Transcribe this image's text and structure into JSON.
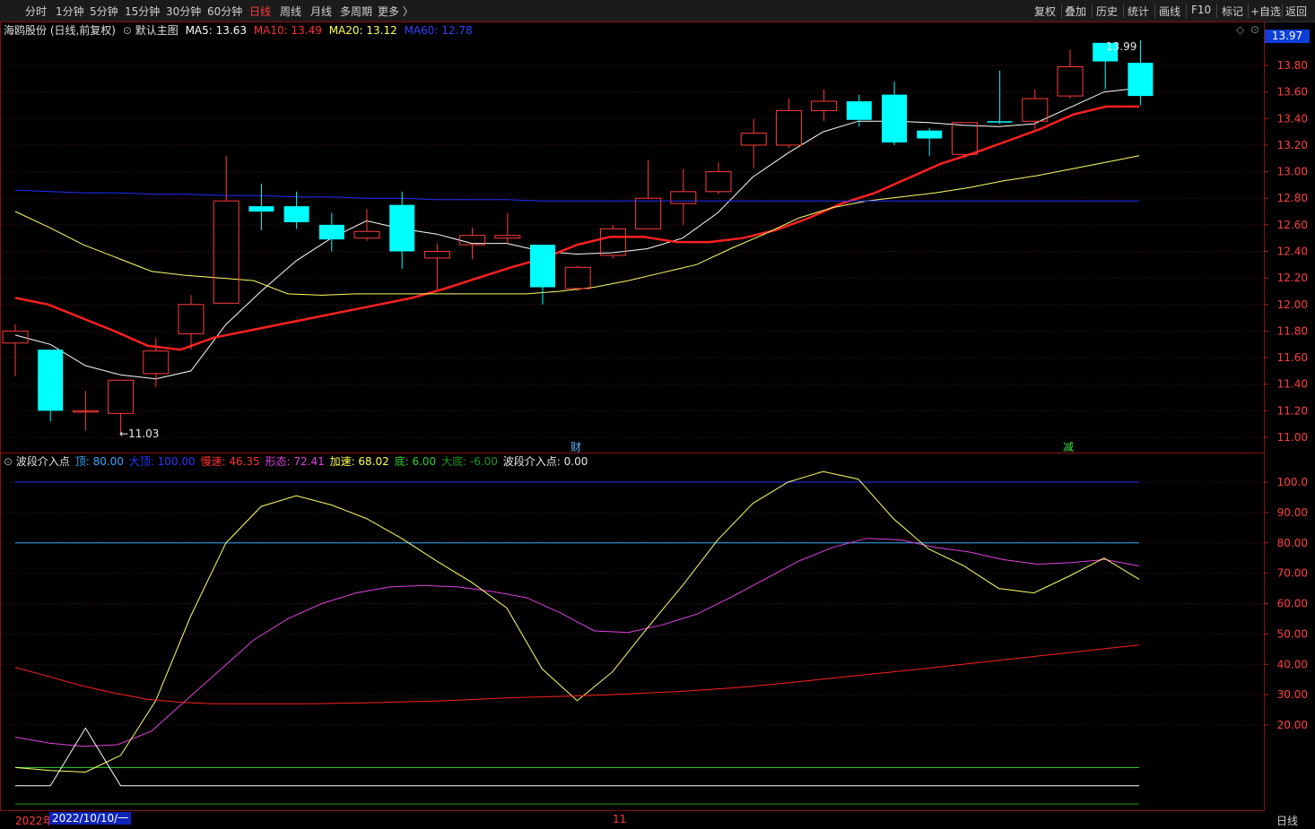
{
  "toolbar": {
    "periods": [
      "分时",
      "1分钟",
      "5分钟",
      "15分钟",
      "30分钟",
      "60分钟",
      "日线",
      "周线",
      "月线",
      "多周期",
      "更多 〉"
    ],
    "active_period": "日线",
    "right": [
      "复权",
      "叠加",
      "历史",
      "统计",
      "画线",
      "F10",
      "标记",
      "+自选",
      "返回"
    ]
  },
  "main_info": {
    "stock": "海鸥股份 (日线,前复权)",
    "template": "默认主图",
    "ma5": "MA5: 13.63",
    "ma10": "MA10: 13.49",
    "ma20": "MA20: 13.12",
    "ma60": "MA60: 12.78"
  },
  "current_price": "13.97",
  "price_axis": [
    "13.80",
    "13.60",
    "13.40",
    "13.20",
    "13.00",
    "12.80",
    "12.60",
    "12.40",
    "12.20",
    "12.00",
    "11.80",
    "11.60",
    "11.40",
    "11.20",
    "11.00"
  ],
  "annotations": {
    "high": "13.99",
    "low": "←11.03",
    "marker_cai": "财",
    "marker_jian": "减"
  },
  "indicator_info": {
    "name": "波段介入点",
    "top": "顶: 80.00",
    "big_top": "大顶: 100.00",
    "slow": "慢速: 46.35",
    "shape": "形态: 72.41",
    "fast": "加速: 68.02",
    "bottom": "底: 6.00",
    "big_bottom": "大底: -6.00",
    "entry": "波段介入点: 0.00"
  },
  "indicator_axis": [
    "100.0",
    "90.00",
    "80.00",
    "70.00",
    "60.00",
    "50.00",
    "40.00",
    "30.00",
    "20.00"
  ],
  "bottom_bar": {
    "year": "2022年",
    "date": "2022/10/10/一",
    "month": "11",
    "period": "日线"
  },
  "colors": {
    "up": "#ff3b3b",
    "down": "#00ffff",
    "ma5": "#ffffff",
    "ma10": "#ff2020",
    "ma20": "#ffff66",
    "ma60": "#2030ff"
  },
  "chart_data": {
    "type": "candlestick",
    "candles": [
      {
        "o": 11.71,
        "c": 11.8,
        "h": 11.85,
        "l": 11.46
      },
      {
        "o": 11.66,
        "c": 11.2,
        "h": 11.66,
        "l": 11.12
      },
      {
        "o": 11.2,
        "c": 11.2,
        "h": 11.35,
        "l": 11.05
      },
      {
        "o": 11.18,
        "c": 11.43,
        "h": 11.43,
        "l": 11.03
      },
      {
        "o": 11.48,
        "c": 11.65,
        "h": 11.75,
        "l": 11.38
      },
      {
        "o": 11.78,
        "c": 12.0,
        "h": 12.07,
        "l": 11.66
      },
      {
        "o": 12.01,
        "c": 12.78,
        "h": 13.12,
        "l": 12.01
      },
      {
        "o": 12.74,
        "c": 12.7,
        "h": 12.91,
        "l": 12.56
      },
      {
        "o": 12.74,
        "c": 12.62,
        "h": 12.85,
        "l": 12.57
      },
      {
        "o": 12.6,
        "c": 12.49,
        "h": 12.69,
        "l": 12.4
      },
      {
        "o": 12.5,
        "c": 12.55,
        "h": 12.72,
        "l": 12.48
      },
      {
        "o": 12.75,
        "c": 12.4,
        "h": 12.85,
        "l": 12.27
      },
      {
        "o": 12.35,
        "c": 12.4,
        "h": 12.46,
        "l": 12.11
      },
      {
        "o": 12.45,
        "c": 12.52,
        "h": 12.58,
        "l": 12.34
      },
      {
        "o": 12.5,
        "c": 12.52,
        "h": 12.69,
        "l": 12.46
      },
      {
        "o": 12.45,
        "c": 12.13,
        "h": 12.45,
        "l": 12.0
      },
      {
        "o": 12.12,
        "c": 12.28,
        "h": 12.29,
        "l": 12.1
      },
      {
        "o": 12.37,
        "c": 12.57,
        "h": 12.6,
        "l": 12.35
      },
      {
        "o": 12.57,
        "c": 12.8,
        "h": 13.09,
        "l": 12.57
      },
      {
        "o": 12.76,
        "c": 12.85,
        "h": 13.02,
        "l": 12.6
      },
      {
        "o": 12.85,
        "c": 13.0,
        "h": 13.07,
        "l": 12.83
      },
      {
        "o": 13.2,
        "c": 13.29,
        "h": 13.4,
        "l": 13.03
      },
      {
        "o": 13.2,
        "c": 13.46,
        "h": 13.55,
        "l": 13.18
      },
      {
        "o": 13.46,
        "c": 13.53,
        "h": 13.62,
        "l": 13.38
      },
      {
        "o": 13.53,
        "c": 13.39,
        "h": 13.58,
        "l": 13.34
      },
      {
        "o": 13.58,
        "c": 13.22,
        "h": 13.68,
        "l": 13.2
      },
      {
        "o": 13.31,
        "c": 13.25,
        "h": 13.33,
        "l": 13.12
      },
      {
        "o": 13.13,
        "c": 13.37,
        "h": 13.37,
        "l": 13.1
      },
      {
        "o": 13.38,
        "c": 13.37,
        "h": 13.76,
        "l": 13.36
      },
      {
        "o": 13.38,
        "c": 13.55,
        "h": 13.62,
        "l": 13.32
      },
      {
        "o": 13.57,
        "c": 13.79,
        "h": 13.92,
        "l": 13.55
      },
      {
        "o": 13.97,
        "c": 13.83,
        "h": 13.97,
        "l": 13.62
      },
      {
        "o": 13.82,
        "c": 13.57,
        "h": 13.99,
        "l": 13.5
      }
    ],
    "ma_series": [
      {
        "name": "MA5",
        "values": [
          11.77,
          11.7,
          11.54,
          11.47,
          11.44,
          11.5,
          11.85,
          12.1,
          12.33,
          12.5,
          12.63,
          12.57,
          12.53,
          12.46,
          12.46,
          12.4,
          12.38,
          12.39,
          12.42,
          12.5,
          12.69,
          12.96,
          13.14,
          13.3,
          13.38,
          13.38,
          13.37,
          13.35,
          13.34,
          13.36,
          13.48,
          13.6,
          13.63
        ]
      },
      {
        "name": "MA10",
        "values": [
          12.05,
          12.0,
          11.9,
          11.8,
          11.69,
          11.66,
          11.75,
          11.8,
          11.85,
          11.9,
          11.95,
          12.0,
          12.05,
          12.12,
          12.2,
          12.28,
          12.35,
          12.45,
          12.51,
          12.51,
          12.47,
          12.47,
          12.5,
          12.56,
          12.65,
          12.76,
          12.84,
          12.95,
          13.06,
          13.14,
          13.23,
          13.32,
          13.43,
          13.49,
          13.49
        ]
      },
      {
        "name": "MA20",
        "values": [
          12.7,
          12.58,
          12.45,
          12.35,
          12.25,
          12.22,
          12.2,
          12.18,
          12.08,
          12.07,
          12.08,
          12.08,
          12.08,
          12.08,
          12.08,
          12.08,
          12.1,
          12.13,
          12.18,
          12.24,
          12.3,
          12.42,
          12.53,
          12.65,
          12.73,
          12.78,
          12.81,
          12.84,
          12.88,
          12.93,
          12.97,
          13.02,
          13.07,
          13.12
        ]
      },
      {
        "name": "MA60",
        "values": [
          12.86,
          12.85,
          12.84,
          12.84,
          12.83,
          12.83,
          12.82,
          12.82,
          12.81,
          12.81,
          12.8,
          12.8,
          12.79,
          12.79,
          12.79,
          12.78,
          12.78,
          12.78,
          12.78,
          12.78,
          12.78,
          12.78,
          12.78,
          12.78,
          12.78,
          12.78,
          12.78,
          12.78,
          12.78,
          12.78,
          12.78,
          12.78,
          12.78
        ]
      }
    ],
    "indicator_series": [
      {
        "name": "形态",
        "values": [
          16,
          14,
          13,
          13.5,
          18,
          28,
          38,
          48,
          55,
          60,
          63.5,
          65.5,
          66,
          65.5,
          64,
          62,
          57,
          51,
          50.5,
          53,
          56.5,
          62,
          68,
          74,
          78.5,
          81.5,
          81,
          78.5,
          77,
          74.5,
          73,
          73.5,
          74.5,
          72.4
        ]
      },
      {
        "name": "加速",
        "values": [
          6,
          5,
          4.5,
          10,
          28,
          56,
          80,
          92,
          95.5,
          92.5,
          88,
          81.5,
          74,
          67,
          58.5,
          38.5,
          28,
          37.5,
          52,
          66,
          81,
          93,
          100,
          103.5,
          101,
          88,
          78,
          72.5,
          65,
          63.5,
          69,
          75,
          68
        ]
      },
      {
        "name": "慢速",
        "values": [
          39,
          36,
          33,
          30.5,
          28.5,
          27.5,
          27,
          27,
          27,
          27,
          27.2,
          27.4,
          27.7,
          28,
          28.5,
          29,
          29.3,
          29.6,
          30,
          30.5,
          31,
          31.7,
          32.5,
          33.5,
          34.6,
          35.8,
          36.9,
          38,
          39.2,
          40.4,
          41.6,
          42.8,
          44,
          45.2,
          46.35
        ]
      },
      {
        "name": "波段介入点",
        "values": [
          0,
          0,
          19,
          0,
          0,
          0,
          0,
          0,
          0,
          0,
          0,
          0,
          0,
          0,
          0,
          0,
          0,
          0,
          0,
          0,
          0,
          0,
          0,
          0,
          0,
          0,
          0,
          0,
          0,
          0,
          0,
          0,
          0
        ]
      }
    ],
    "reference_lines": [
      {
        "name": "大顶",
        "value": 100
      },
      {
        "name": "顶",
        "value": 80
      },
      {
        "name": "底",
        "value": 6
      },
      {
        "name": "大底",
        "value": -6
      }
    ],
    "price_range": [
      11.0,
      13.99
    ],
    "indicator_range": [
      -6,
      104
    ]
  }
}
